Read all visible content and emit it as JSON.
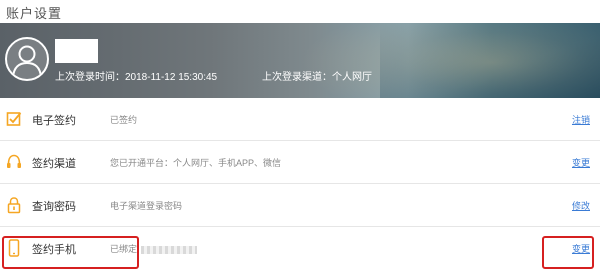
{
  "page": {
    "title": "账户设置"
  },
  "profile": {
    "last_login_time_label": "上次登录时间：",
    "last_login_time": "2018-11-12 15:30:45",
    "last_login_channel_label": "上次登录渠道：",
    "last_login_channel": "个人网厅"
  },
  "rows": [
    {
      "label": "电子签约",
      "desc": "已签约",
      "action": "注销",
      "icon": "checkbox-icon"
    },
    {
      "label": "签约渠道",
      "desc": "您已开通平台：个人网厅、手机APP、微信",
      "action": "变更",
      "icon": "headset-icon"
    },
    {
      "label": "查询密码",
      "desc": "电子渠道登录密码",
      "action": "修改",
      "icon": "lock-icon"
    },
    {
      "label": "签约手机",
      "desc": "已绑定",
      "action": "变更",
      "icon": "phone-icon"
    }
  ],
  "colors": {
    "accent": "#f5a623",
    "link": "#3a7bd5",
    "highlight": "#d62020"
  }
}
